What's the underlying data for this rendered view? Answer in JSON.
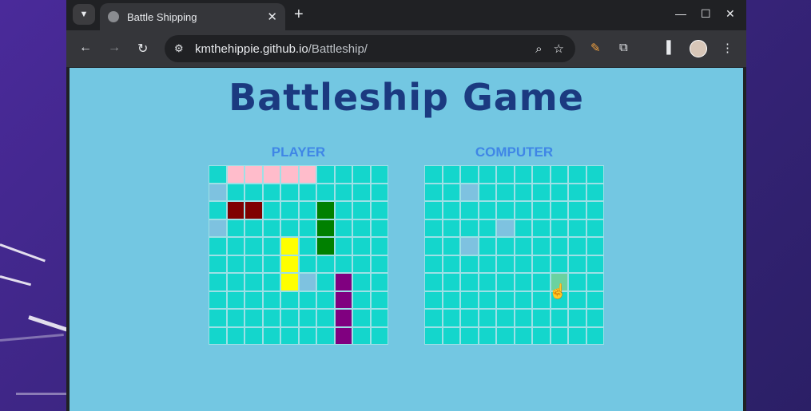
{
  "browser": {
    "tab_title": "Battle Shipping",
    "url_host": "kmthehippie.github.io",
    "url_path": "/Battleship/"
  },
  "page": {
    "title": "Battleship Game",
    "player_label": "PLAYER",
    "computer_label": "COMPUTER"
  },
  "colors": {
    "page_bg": "#73c7e2",
    "cell_water": "#14d6cc",
    "cell_miss": "#7ec2e0",
    "ship_pink": "#ffbccb",
    "ship_maroon": "#800000",
    "ship_green": "#008000",
    "ship_yellow": "#ffff00",
    "ship_purple": "#800080",
    "hover": "#6ad2a0"
  },
  "player_board": {
    "ships": [
      {
        "color": "ship_pink",
        "cells": [
          [
            0,
            1
          ],
          [
            0,
            2
          ],
          [
            0,
            3
          ],
          [
            0,
            4
          ],
          [
            0,
            5
          ]
        ]
      },
      {
        "color": "ship_maroon",
        "cells": [
          [
            2,
            1
          ],
          [
            2,
            2
          ]
        ]
      },
      {
        "color": "ship_green",
        "cells": [
          [
            2,
            6
          ],
          [
            3,
            6
          ],
          [
            4,
            6
          ]
        ]
      },
      {
        "color": "ship_yellow",
        "cells": [
          [
            4,
            4
          ],
          [
            5,
            4
          ],
          [
            6,
            4
          ]
        ]
      },
      {
        "color": "ship_purple",
        "cells": [
          [
            6,
            7
          ],
          [
            7,
            7
          ],
          [
            8,
            7
          ],
          [
            9,
            7
          ]
        ]
      }
    ],
    "misses": [
      [
        1,
        0
      ],
      [
        3,
        0
      ],
      [
        6,
        5
      ]
    ]
  },
  "computer_board": {
    "misses": [
      [
        1,
        2
      ],
      [
        3,
        4
      ],
      [
        4,
        2
      ]
    ],
    "hover": [
      6,
      7
    ]
  }
}
